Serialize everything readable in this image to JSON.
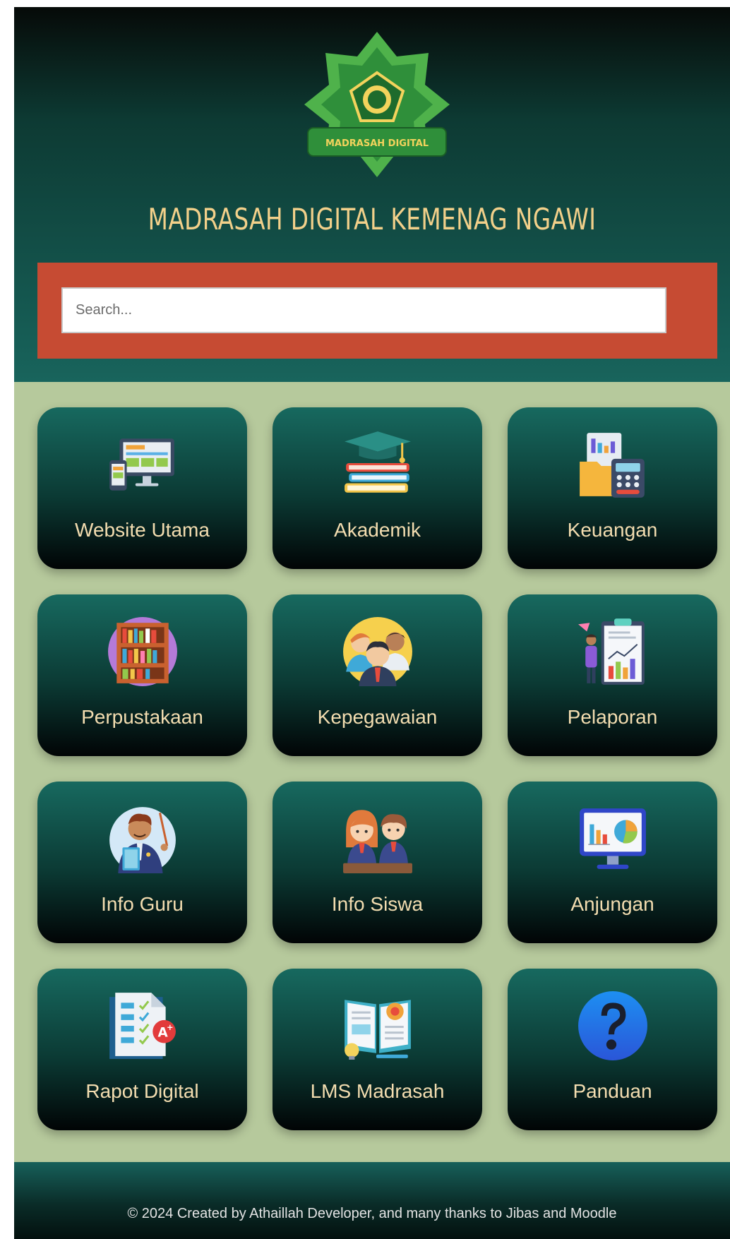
{
  "header": {
    "logo_text": "MADRASAH DIGITAL",
    "title": "MADRASAH DIGITAL KEMENAG NGAWI"
  },
  "search": {
    "placeholder": "Search..."
  },
  "menu": {
    "items": [
      {
        "label": "Website Utama",
        "icon": "website-devices-icon"
      },
      {
        "label": "Akademik",
        "icon": "graduation-books-icon"
      },
      {
        "label": "Keuangan",
        "icon": "finance-calculator-icon"
      },
      {
        "label": "Perpustakaan",
        "icon": "library-bookshelf-icon"
      },
      {
        "label": "Kepegawaian",
        "icon": "staff-people-icon"
      },
      {
        "label": "Pelaporan",
        "icon": "report-chart-icon"
      },
      {
        "label": "Info Guru",
        "icon": "teacher-icon"
      },
      {
        "label": "Info Siswa",
        "icon": "students-icon"
      },
      {
        "label": "Anjungan",
        "icon": "monitor-chart-icon"
      },
      {
        "label": "Rapot Digital",
        "icon": "report-card-icon"
      },
      {
        "label": "LMS Madrasah",
        "icon": "open-book-lms-icon"
      },
      {
        "label": "Panduan",
        "icon": "question-mark-icon"
      }
    ]
  },
  "footer": {
    "text": "© 2024 Created by Athaillah Developer, and many thanks to Jibas and Moodle"
  },
  "colors": {
    "header_dark": "#060a08",
    "header_teal": "#18645c",
    "search_band": "#c64b33",
    "body_bg": "#b6c99c",
    "title_gold": "#f2d08a",
    "tile_label": "#f3ddb0"
  }
}
